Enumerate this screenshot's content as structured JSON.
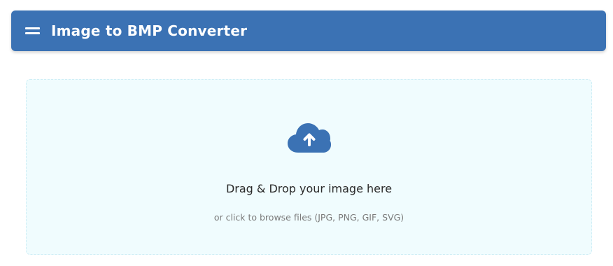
{
  "header": {
    "title": "Image to BMP Converter",
    "menu_icon": "hamburger-menu-icon",
    "background_color": "#3b72b4"
  },
  "dropzone": {
    "icon": "cloud-upload-icon",
    "primary_text": "Drag & Drop your image here",
    "secondary_text": "or click to browse files (JPG, PNG, GIF, SVG)",
    "background_color": "#f0fcfe",
    "icon_color": "#3b72b4"
  }
}
